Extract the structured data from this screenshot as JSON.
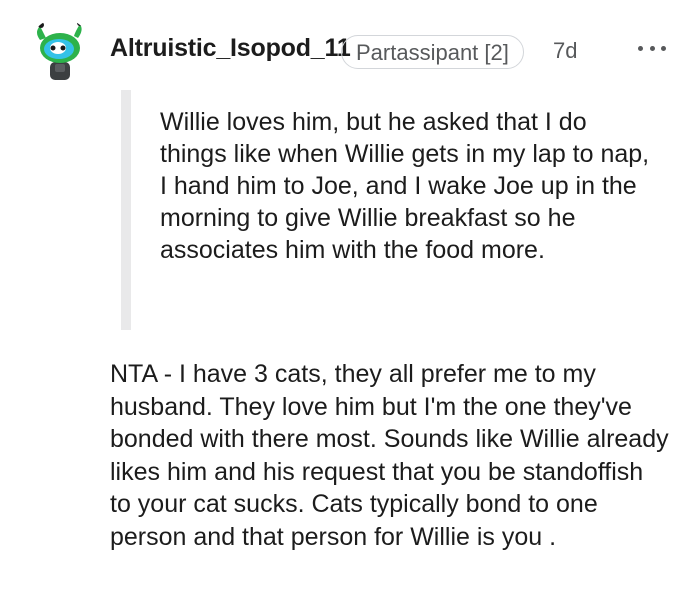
{
  "comment": {
    "author": "Altruistic_Isopod_11",
    "flair": "Partassipant [2]",
    "age": "7d",
    "quote": "Willie loves him, but he asked that I do things like when Willie gets in my lap to nap, I hand him to Joe, and I wake Joe up in the morning to give Willie breakfast so he associates him with the food more.",
    "body": "NTA - I have 3 cats, they all prefer me to my husband. They love him but I'm the one they've bonded with there most. Sounds like Willie already likes him and his request that you be standoffish to your cat sucks. Cats typically bond to one person and that person for Willie is you ."
  },
  "icons": {
    "avatar": "snoo-avatar",
    "more": "more-options-icon"
  },
  "colors": {
    "text": "#1c1c1c",
    "muted": "#57595b",
    "quote_bar": "#e9e9ea",
    "flair_border": "#d3d6da",
    "avatar_green": "#2db24b"
  }
}
